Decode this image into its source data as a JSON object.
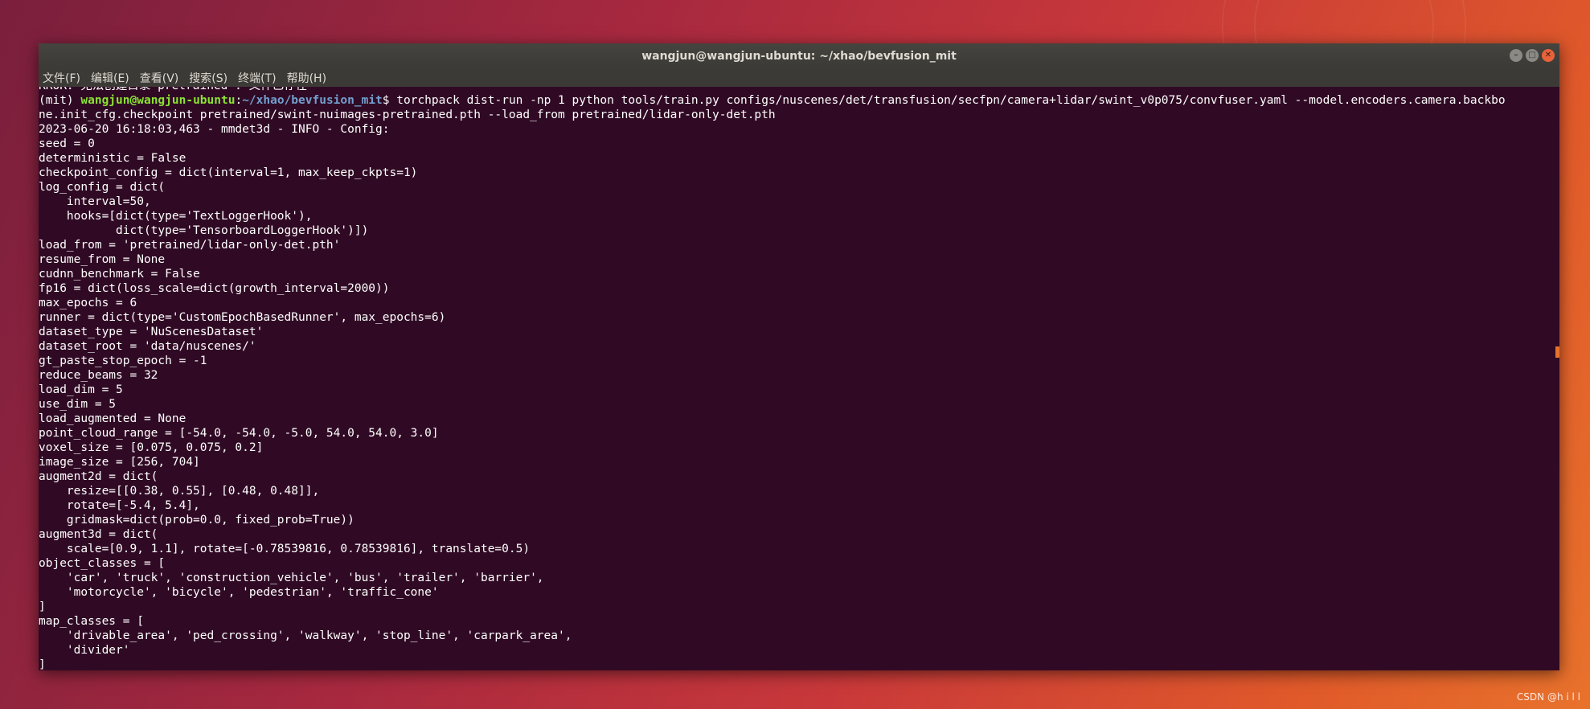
{
  "window": {
    "title": "wangjun@wangjun-ubuntu: ~/xhao/bevfusion_mit"
  },
  "window_buttons": {
    "minimize_icon": "minimize-icon",
    "maximize_icon": "maximize-icon",
    "close_icon": "close-icon"
  },
  "menubar": {
    "items": [
      "文件(F)",
      "编辑(E)",
      "查看(V)",
      "搜索(S)",
      "终端(T)",
      "帮助(H)"
    ]
  },
  "terminal": {
    "partial_top_line": "RROR: 无法创建目录 pretrained : 文件已存在",
    "prompt_env": "(mit) ",
    "prompt_user": "wangjun@wangjun-ubuntu",
    "prompt_sep": ":",
    "prompt_path": "~/xhao/bevfusion_mit",
    "prompt_symbol": "$ ",
    "command_part1": "torchpack dist-run -np 1 python tools/train.py configs/nuscenes/det/transfusion/secfpn/camera+lidar/swint_v0p075/convfuser.yaml --model.encoders.camera.backbo",
    "command_part2": "ne.init_cfg.checkpoint pretrained/swint-nuimages-pretrained.pth --load_from pretrained/lidar-only-det.pth",
    "output_lines": [
      "2023-06-20 16:18:03,463 - mmdet3d - INFO - Config:",
      "seed = 0",
      "deterministic = False",
      "checkpoint_config = dict(interval=1, max_keep_ckpts=1)",
      "log_config = dict(",
      "    interval=50,",
      "    hooks=[dict(type='TextLoggerHook'),",
      "           dict(type='TensorboardLoggerHook')])",
      "load_from = 'pretrained/lidar-only-det.pth'",
      "resume_from = None",
      "cudnn_benchmark = False",
      "fp16 = dict(loss_scale=dict(growth_interval=2000))",
      "max_epochs = 6",
      "runner = dict(type='CustomEpochBasedRunner', max_epochs=6)",
      "dataset_type = 'NuScenesDataset'",
      "dataset_root = 'data/nuscenes/'",
      "gt_paste_stop_epoch = -1",
      "reduce_beams = 32",
      "load_dim = 5",
      "use_dim = 5",
      "load_augmented = None",
      "point_cloud_range = [-54.0, -54.0, -5.0, 54.0, 54.0, 3.0]",
      "voxel_size = [0.075, 0.075, 0.2]",
      "image_size = [256, 704]",
      "augment2d = dict(",
      "    resize=[[0.38, 0.55], [0.48, 0.48]],",
      "    rotate=[-5.4, 5.4],",
      "    gridmask=dict(prob=0.0, fixed_prob=True))",
      "augment3d = dict(",
      "    scale=[0.9, 1.1], rotate=[-0.78539816, 0.78539816], translate=0.5)",
      "object_classes = [",
      "    'car', 'truck', 'construction_vehicle', 'bus', 'trailer', 'barrier',",
      "    'motorcycle', 'bicycle', 'pedestrian', 'traffic_cone'",
      "]",
      "map_classes = [",
      "    'drivable_area', 'ped_crossing', 'walkway', 'stop_line', 'carpark_area',",
      "    'divider'",
      "]"
    ]
  },
  "watermark": "CSDN @h i l l",
  "colors": {
    "terminal_bg": "#300a24",
    "prompt_user": "#8ae234",
    "prompt_path": "#729fcf",
    "close_button": "#e8623a"
  }
}
